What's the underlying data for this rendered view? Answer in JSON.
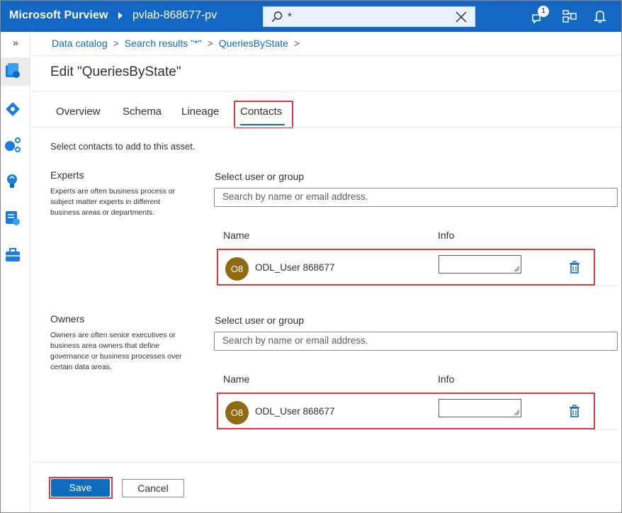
{
  "topbar": {
    "brand": "Microsoft Purview",
    "account": "pvlab-868677-pv",
    "search_value": "*",
    "notification_count": "1"
  },
  "rail": {
    "expand_glyph": "»",
    "items": [
      "data-catalog-icon",
      "data-map-icon",
      "data-share-icon",
      "insights-icon",
      "policy-icon",
      "management-icon"
    ]
  },
  "breadcrumb": {
    "items": [
      "Data catalog",
      "Search results \"*\"",
      "QueriesByState"
    ],
    "separator": ">"
  },
  "page": {
    "title": "Edit \"QueriesByState\""
  },
  "tabs": [
    {
      "label": "Overview"
    },
    {
      "label": "Schema"
    },
    {
      "label": "Lineage"
    },
    {
      "label": "Contacts",
      "selected": true
    }
  ],
  "intro": "Select contacts to add to this asset.",
  "experts": {
    "title": "Experts",
    "description": "Experts are often business process or subject matter experts in different business areas or departments.",
    "select_label": "Select user or group",
    "search_placeholder": "Search by name or email address.",
    "col_name": "Name",
    "col_info": "Info",
    "contacts": [
      {
        "initials": "O8",
        "name": "ODL_User 868677",
        "info": ""
      }
    ]
  },
  "owners": {
    "title": "Owners",
    "description": "Owners are often senior executives or business area owners that define governance or business processes over certain data areas.",
    "select_label": "Select user or group",
    "search_placeholder": "Search by name or email address.",
    "col_name": "Name",
    "col_info": "Info",
    "contacts": [
      {
        "initials": "O8",
        "name": "ODL_User 868677",
        "info": ""
      }
    ]
  },
  "actions": {
    "save": "Save",
    "cancel": "Cancel"
  },
  "colors": {
    "brand_blue": "#1468c4",
    "primary": "#0f6cbd",
    "highlight_red": "#e0383e",
    "avatar": "#8f6a12"
  }
}
